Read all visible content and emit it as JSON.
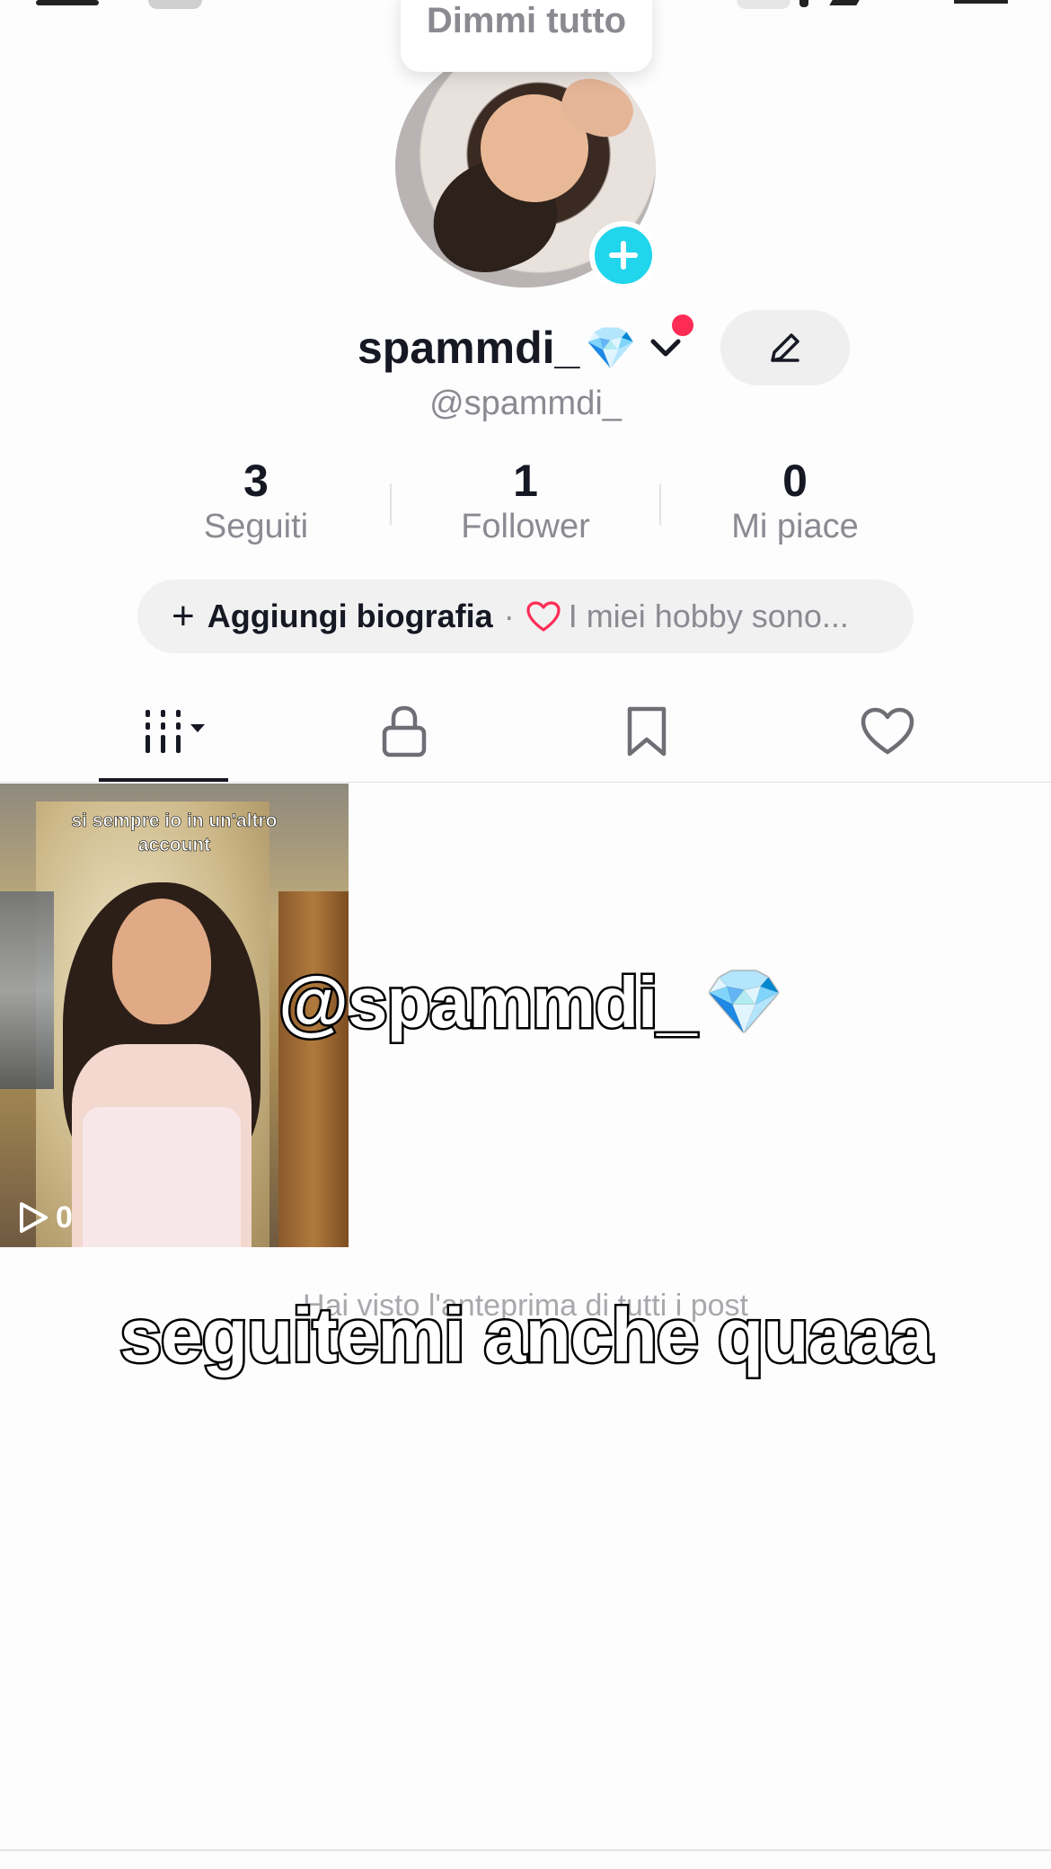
{
  "tooltip": {
    "text": "Dimmi tutto"
  },
  "profile": {
    "display_name": "spammdi_",
    "name_emoji": "💎",
    "handle": "@spammdi_",
    "edit_icon": "pencil-icon",
    "add_avatar_icon": "plus-icon"
  },
  "stats": [
    {
      "value": "3",
      "label": "Seguiti"
    },
    {
      "value": "1",
      "label": "Follower"
    },
    {
      "value": "0",
      "label": "Mi piace"
    }
  ],
  "bio": {
    "plus": "+",
    "add_label": "Aggiungi biografia",
    "separator": "·",
    "hint": "I miei hobby sono..."
  },
  "tabs": [
    {
      "icon": "videos-grid-icon",
      "active": true
    },
    {
      "icon": "lock-icon",
      "active": false
    },
    {
      "icon": "bookmark-icon",
      "active": false
    },
    {
      "icon": "heart-icon",
      "active": false
    }
  ],
  "video": {
    "caption": "si sempre io in un'altro account",
    "views": "0"
  },
  "footer_note": "Hai visto l'anteprima di tutti i post",
  "overlays": {
    "handle_text": "@spammdi_",
    "handle_emoji": "💎",
    "follow_text": "seguitemi anche quaaa"
  },
  "colors": {
    "accent_cyan": "#20d5ec",
    "notification_red": "#fe2c55",
    "text_primary": "#161823",
    "text_secondary": "#8a8b91"
  }
}
